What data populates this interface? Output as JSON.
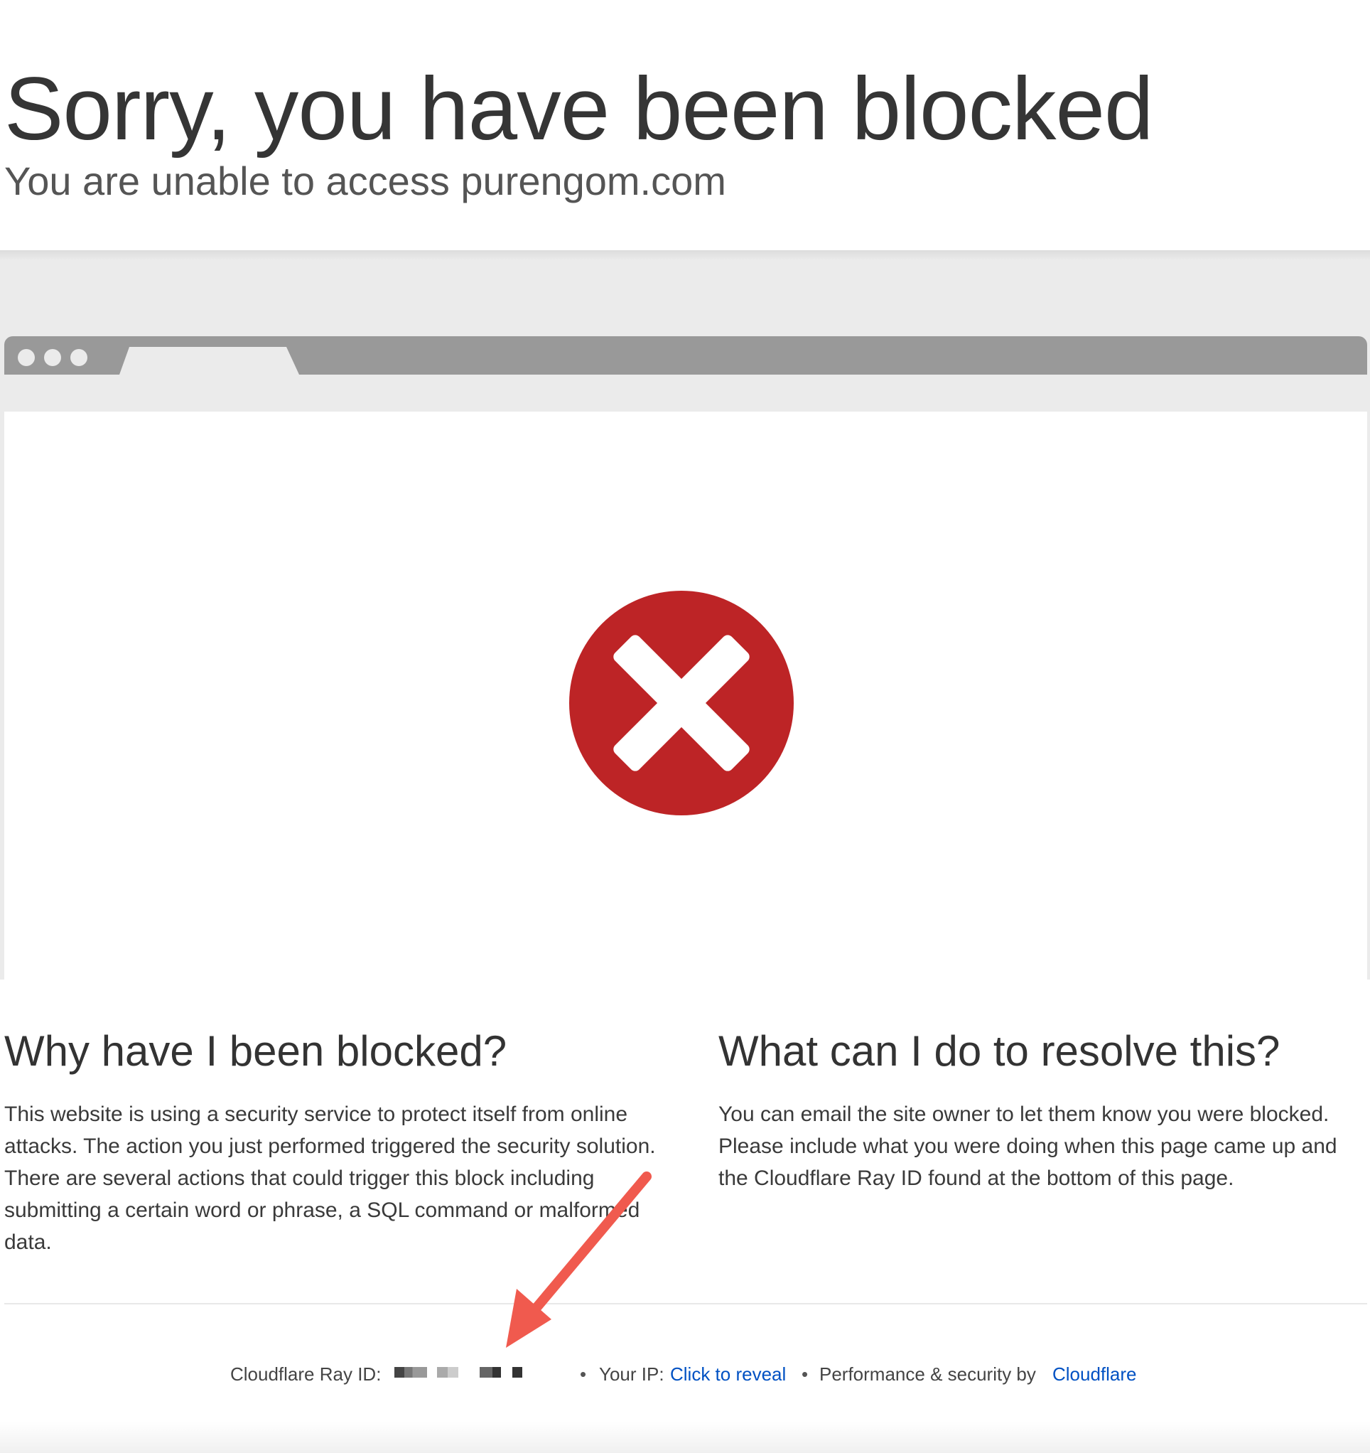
{
  "header": {
    "title": "Sorry, you have been blocked",
    "subtitle": "You are unable to access purengom.com"
  },
  "illustration": {
    "icon": "error-x-icon",
    "error_color": "#bd2426"
  },
  "why": {
    "heading": "Why have I been blocked?",
    "body": "This website is using a security service to protect itself from online attacks. The action you just performed triggered the security solution. There are several actions that could trigger this block including submitting a certain word or phrase, a SQL command or malformed data."
  },
  "resolve": {
    "heading": "What can I do to resolve this?",
    "body": "You can email the site owner to let them know you were blocked. Please include what you were doing when this page came up and the Cloudflare Ray ID found at the bottom of this page."
  },
  "footer": {
    "ray_id_label": "Cloudflare Ray ID:",
    "separator": "•",
    "ip_label": "Your IP:",
    "ip_link": "Click to reveal",
    "perf_label": "Performance & security by",
    "cloudflare_link": "Cloudflare",
    "link_color": "#0051c3"
  },
  "annotation": {
    "arrow_color": "#f05a4e"
  }
}
